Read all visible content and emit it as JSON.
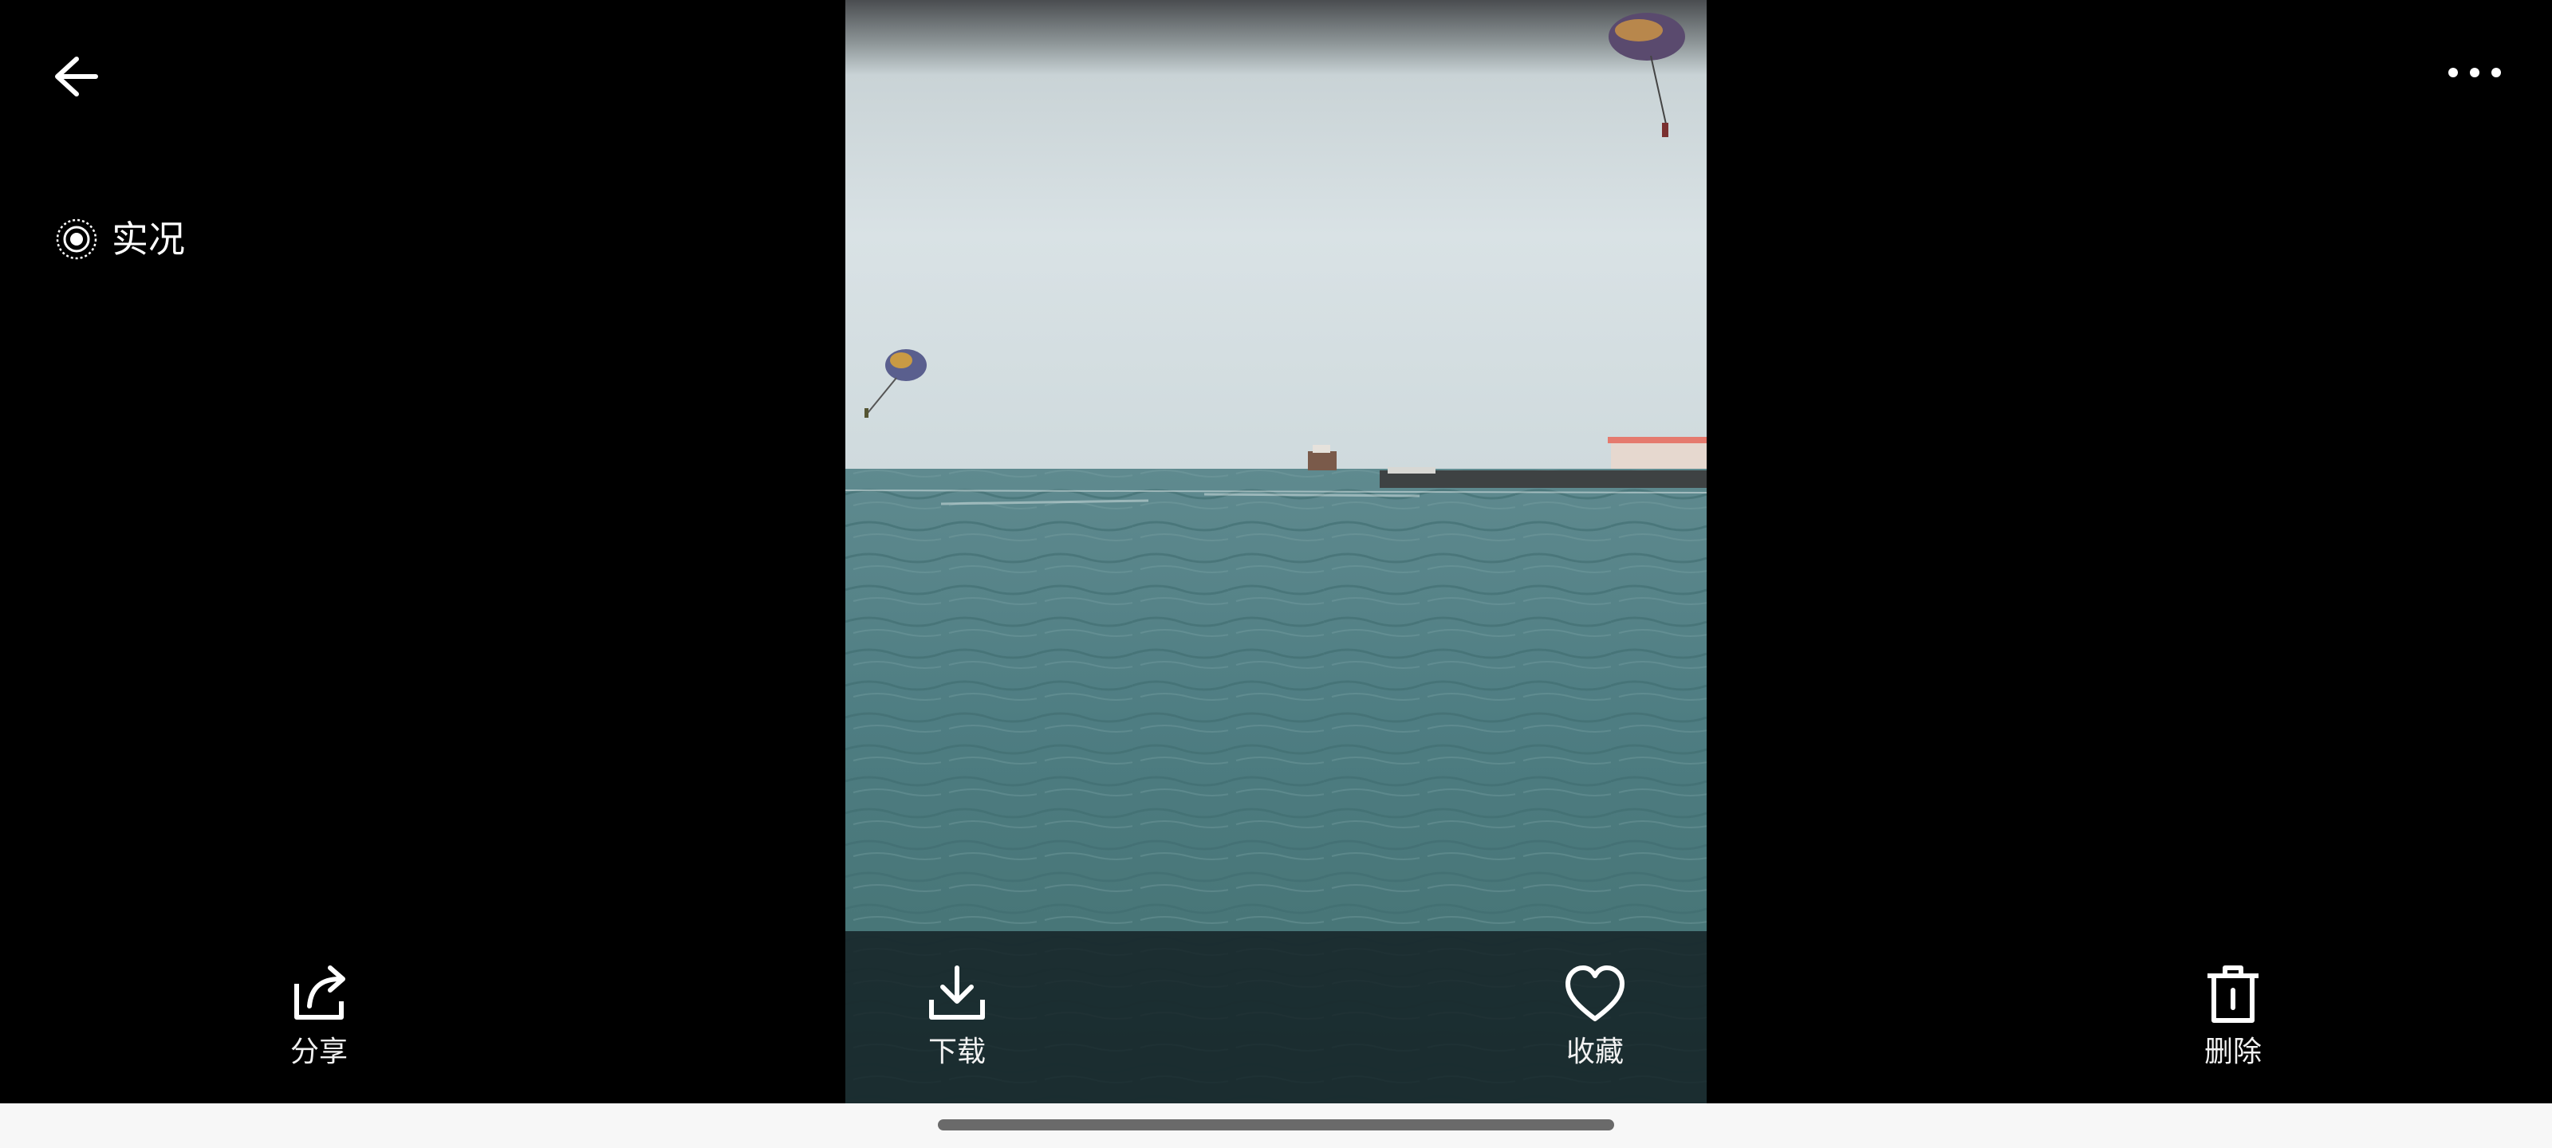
{
  "header": {
    "back_icon": "arrow-left-icon",
    "more_icon": "more-horizontal-icon"
  },
  "live_photo": {
    "icon": "live-photo-icon",
    "label": "实况"
  },
  "photo": {
    "description_icon": "photo"
  },
  "toolbar": {
    "share": {
      "icon": "share-icon",
      "label": "分享"
    },
    "download": {
      "icon": "download-icon",
      "label": "下载"
    },
    "favorite": {
      "icon": "heart-icon",
      "label": "收藏"
    },
    "delete": {
      "icon": "trash-icon",
      "label": "删除"
    }
  },
  "colors": {
    "background": "#000000",
    "sky": "#d3dde0",
    "sea": "#4f7f83",
    "toolbar_overlay": "#121e22",
    "nav_bar": "#f7f7f7"
  }
}
